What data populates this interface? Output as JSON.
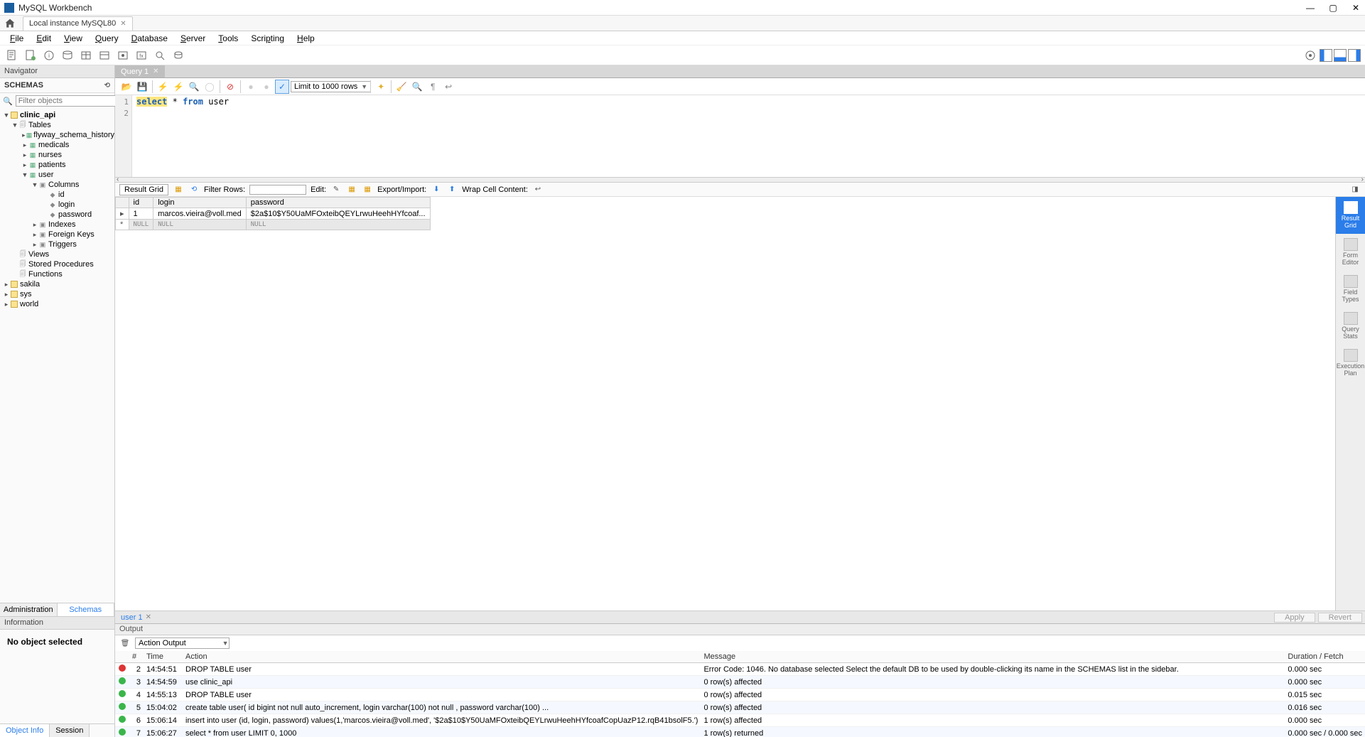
{
  "title": "MySQL Workbench",
  "conn_tab": "Local instance MySQL80",
  "menu": {
    "file": "File",
    "edit": "Edit",
    "view": "View",
    "query": "Query",
    "database": "Database",
    "server": "Server",
    "tools": "Tools",
    "scripting": "Scripting",
    "help": "Help"
  },
  "nav": {
    "header": "Navigator",
    "schemas_label": "SCHEMAS",
    "filter_placeholder": "Filter objects",
    "tabs": {
      "admin": "Administration",
      "schemas": "Schemas"
    }
  },
  "tree": {
    "clinic": "clinic_api",
    "tables": "Tables",
    "t_flyway": "flyway_schema_history",
    "t_medicals": "medicals",
    "t_nurses": "nurses",
    "t_patients": "patients",
    "t_user": "user",
    "columns": "Columns",
    "c_id": "id",
    "c_login": "login",
    "c_password": "password",
    "indexes": "Indexes",
    "fk": "Foreign Keys",
    "triggers": "Triggers",
    "views": "Views",
    "sp": "Stored Procedures",
    "functions": "Functions",
    "sakila": "sakila",
    "sys": "sys",
    "world": "world"
  },
  "info": {
    "header": "Information",
    "body": "No object selected",
    "tabs": {
      "obj": "Object Info",
      "session": "Session"
    }
  },
  "qtab": "Query 1",
  "editor": {
    "limit": "Limit to 1000 rows"
  },
  "code": {
    "l1_num": "1",
    "l2_num": "2",
    "kw_select": "select",
    "star": "*",
    "kw_from": "from",
    "ident": "user"
  },
  "result_toolbar": {
    "grid": "Result Grid",
    "filter": "Filter Rows:",
    "edit": "Edit:",
    "export": "Export/Import:",
    "wrap": "Wrap Cell Content:"
  },
  "grid": {
    "headers": {
      "id": "id",
      "login": "login",
      "password": "password"
    },
    "row1": {
      "id": "1",
      "login": "marcos.vieira@voll.med",
      "password": "$2a$10$Y50UaMFOxteibQEYLrwuHeehHYfcoaf..."
    },
    "null": "NULL"
  },
  "result_tab": "user 1",
  "apply": "Apply",
  "revert": "Revert",
  "sidebar_labels": {
    "result": "Result\nGrid",
    "form": "Form\nEditor",
    "field": "Field\nTypes",
    "qstats": "Query\nStats",
    "plan": "Execution\nPlan"
  },
  "output": {
    "header": "Output",
    "action_output": "Action Output",
    "cols": {
      "num": "#",
      "time": "Time",
      "action": "Action",
      "message": "Message",
      "duration": "Duration / Fetch"
    },
    "rows": [
      {
        "status": "err",
        "num": "2",
        "time": "14:54:51",
        "action": "DROP TABLE user",
        "msg": "Error Code: 1046. No database selected Select the default DB to be used by double-clicking its name in the SCHEMAS list in the sidebar.",
        "dur": "0.000 sec"
      },
      {
        "status": "ok",
        "num": "3",
        "time": "14:54:59",
        "action": "use clinic_api",
        "msg": "0 row(s) affected",
        "dur": "0.000 sec"
      },
      {
        "status": "ok",
        "num": "4",
        "time": "14:55:13",
        "action": "DROP TABLE user",
        "msg": "0 row(s) affected",
        "dur": "0.015 sec"
      },
      {
        "status": "ok",
        "num": "5",
        "time": "15:04:02",
        "action": "create table user(                            id bigint not null auto_increment,                       login varchar(100) not null ,                       password varchar(100) ...",
        "msg": "0 row(s) affected",
        "dur": "0.016 sec"
      },
      {
        "status": "ok",
        "num": "6",
        "time": "15:06:14",
        "action": "insert into user (id, login, password) values(1,'marcos.vieira@voll.med', '$2a$10$Y50UaMFOxteibQEYLrwuHeehHYfcoafCopUazP12.rqB41bsolF5.')",
        "msg": "1 row(s) affected",
        "dur": "0.000 sec"
      },
      {
        "status": "ok",
        "num": "7",
        "time": "15:06:27",
        "action": "select * from user LIMIT 0, 1000",
        "msg": "1 row(s) returned",
        "dur": "0.000 sec / 0.000 sec"
      }
    ]
  }
}
